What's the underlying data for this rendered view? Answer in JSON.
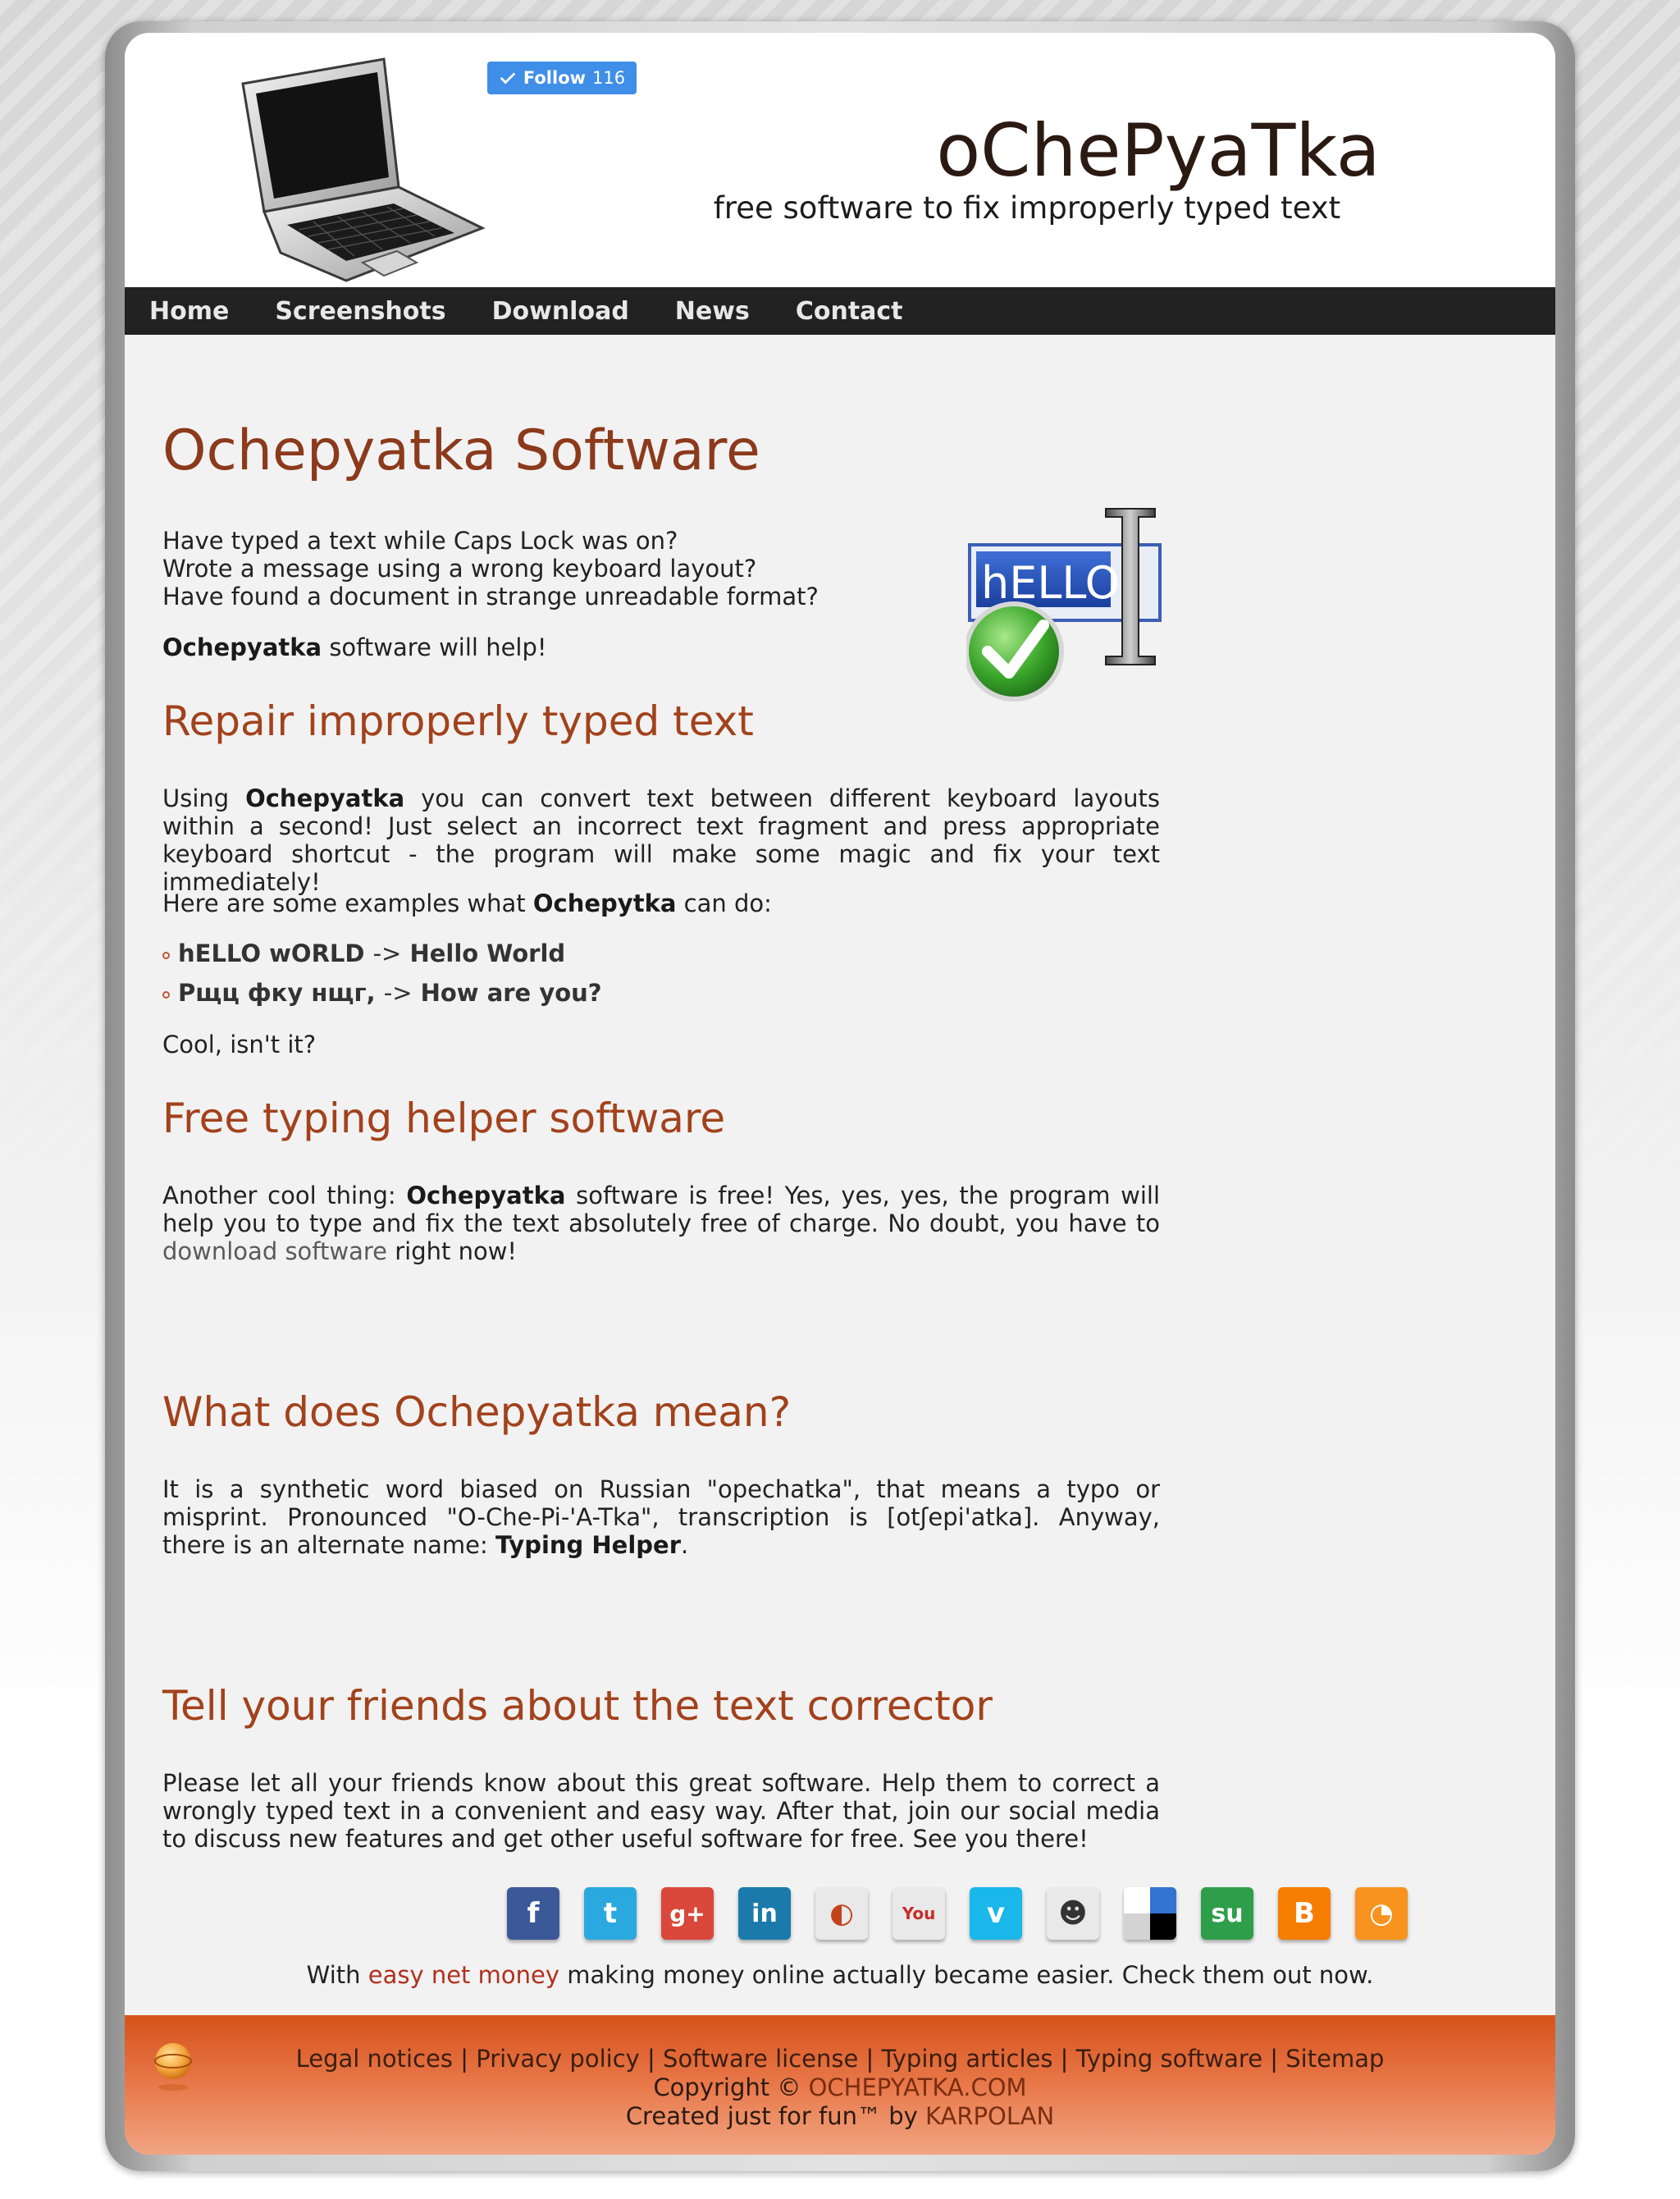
{
  "header": {
    "site_title": "oChePyaTka",
    "tagline": "free software to fix improperly typed text",
    "follow_label": "Follow",
    "follow_count": "116"
  },
  "nav": {
    "items": [
      "Home",
      "Screenshots",
      "Download",
      "News",
      "Contact"
    ]
  },
  "main": {
    "title": "Ochepyatka Software",
    "intro_lines": [
      "Have typed a text while Caps Lock was on?",
      "Wrote a message using a wrong keyboard layout?",
      "Have found a document in strange unreadable format?"
    ],
    "help_bold": "Ochepyatka",
    "help_rest": " software will help!",
    "logo_text": "hELLO",
    "section1": {
      "heading": "Repair improperly typed text",
      "p1_a": "Using ",
      "p1_bold": "Ochepyatka",
      "p1_b": " you can convert text between different keyboard layouts within a second! Just select an incorrect text fragment and press appropriate keyboard shortcut - the program will make some magic and fix your text immediately!",
      "p2_a": "Here are some examples what ",
      "p2_bold": "Ochepytka",
      "p2_b": " can do:",
      "examples": [
        {
          "from": "hELLO wORLD",
          "arrow": "->",
          "to": "Hello World"
        },
        {
          "from": "Рщц фку нщг,",
          "arrow": "->",
          "to": "How are you?"
        }
      ],
      "p3": "Cool, isn't it?"
    },
    "section2": {
      "heading": "Free typing helper software",
      "p_a": "Another cool thing: ",
      "p_bold": "Ochepyatka",
      "p_b": " software is free! Yes, yes, yes, the program will help you to type and fix the text absolutely free of charge. No doubt, you have to ",
      "p_link": "download software",
      "p_c": " right now!"
    },
    "section3": {
      "heading": "What does Ochepyatka mean?",
      "p_a": "It is a synthetic word biased on Russian \"opechatka\", that means a typo or misprint. Pronounced \"O-Che-Pi-'A-Tka\", transcription is [otʃepi'atka]. Anyway, there is an alternate name: ",
      "p_bold": "Typing Helper",
      "p_b": "."
    },
    "section4": {
      "heading": "Tell your friends about the text corrector",
      "p": "Please let all your friends know about this great software. Help them to correct a wrongly typed text in a convenient and easy way. After that, join our social media to discuss new features and get other useful software for free. See you there!"
    }
  },
  "social": [
    {
      "name": "facebook-icon",
      "glyph": "f",
      "color": "#3b5998"
    },
    {
      "name": "twitter-icon",
      "glyph": "t",
      "color": "#2aa9e0"
    },
    {
      "name": "google-plus-icon",
      "glyph": "g+",
      "color": "#d9483b"
    },
    {
      "name": "linkedin-icon",
      "glyph": "in",
      "color": "#1a7aab"
    },
    {
      "name": "picasa-icon",
      "glyph": "◐",
      "color": "#e9e9e9"
    },
    {
      "name": "youtube-icon",
      "glyph": "You",
      "color": "#e9e9e9"
    },
    {
      "name": "vimeo-icon",
      "glyph": "v",
      "color": "#1ab7ea"
    },
    {
      "name": "reddit-icon",
      "glyph": "☻",
      "color": "#e9e9e9"
    },
    {
      "name": "delicious-icon",
      "glyph": "",
      "color": "#ffffff"
    },
    {
      "name": "stumbleupon-icon",
      "glyph": "su",
      "color": "#2f9e4a"
    },
    {
      "name": "blogger-icon",
      "glyph": "B",
      "color": "#f57d00"
    },
    {
      "name": "rss-icon",
      "glyph": "◔",
      "color": "#f7931e"
    }
  ],
  "promo": {
    "a": "With ",
    "link": "easy net money",
    "b": " making money online actually became easier. Check them out now."
  },
  "footer": {
    "links": [
      "Legal notices",
      "Privacy policy",
      "Software license",
      "Typing articles",
      "Typing software",
      "Sitemap"
    ],
    "copyright_prefix": "Copyright © ",
    "copyright_site": "OCHEPYATKA.COM",
    "created_prefix": "Created just for fun™ by ",
    "created_by": "KARPOLAN"
  }
}
